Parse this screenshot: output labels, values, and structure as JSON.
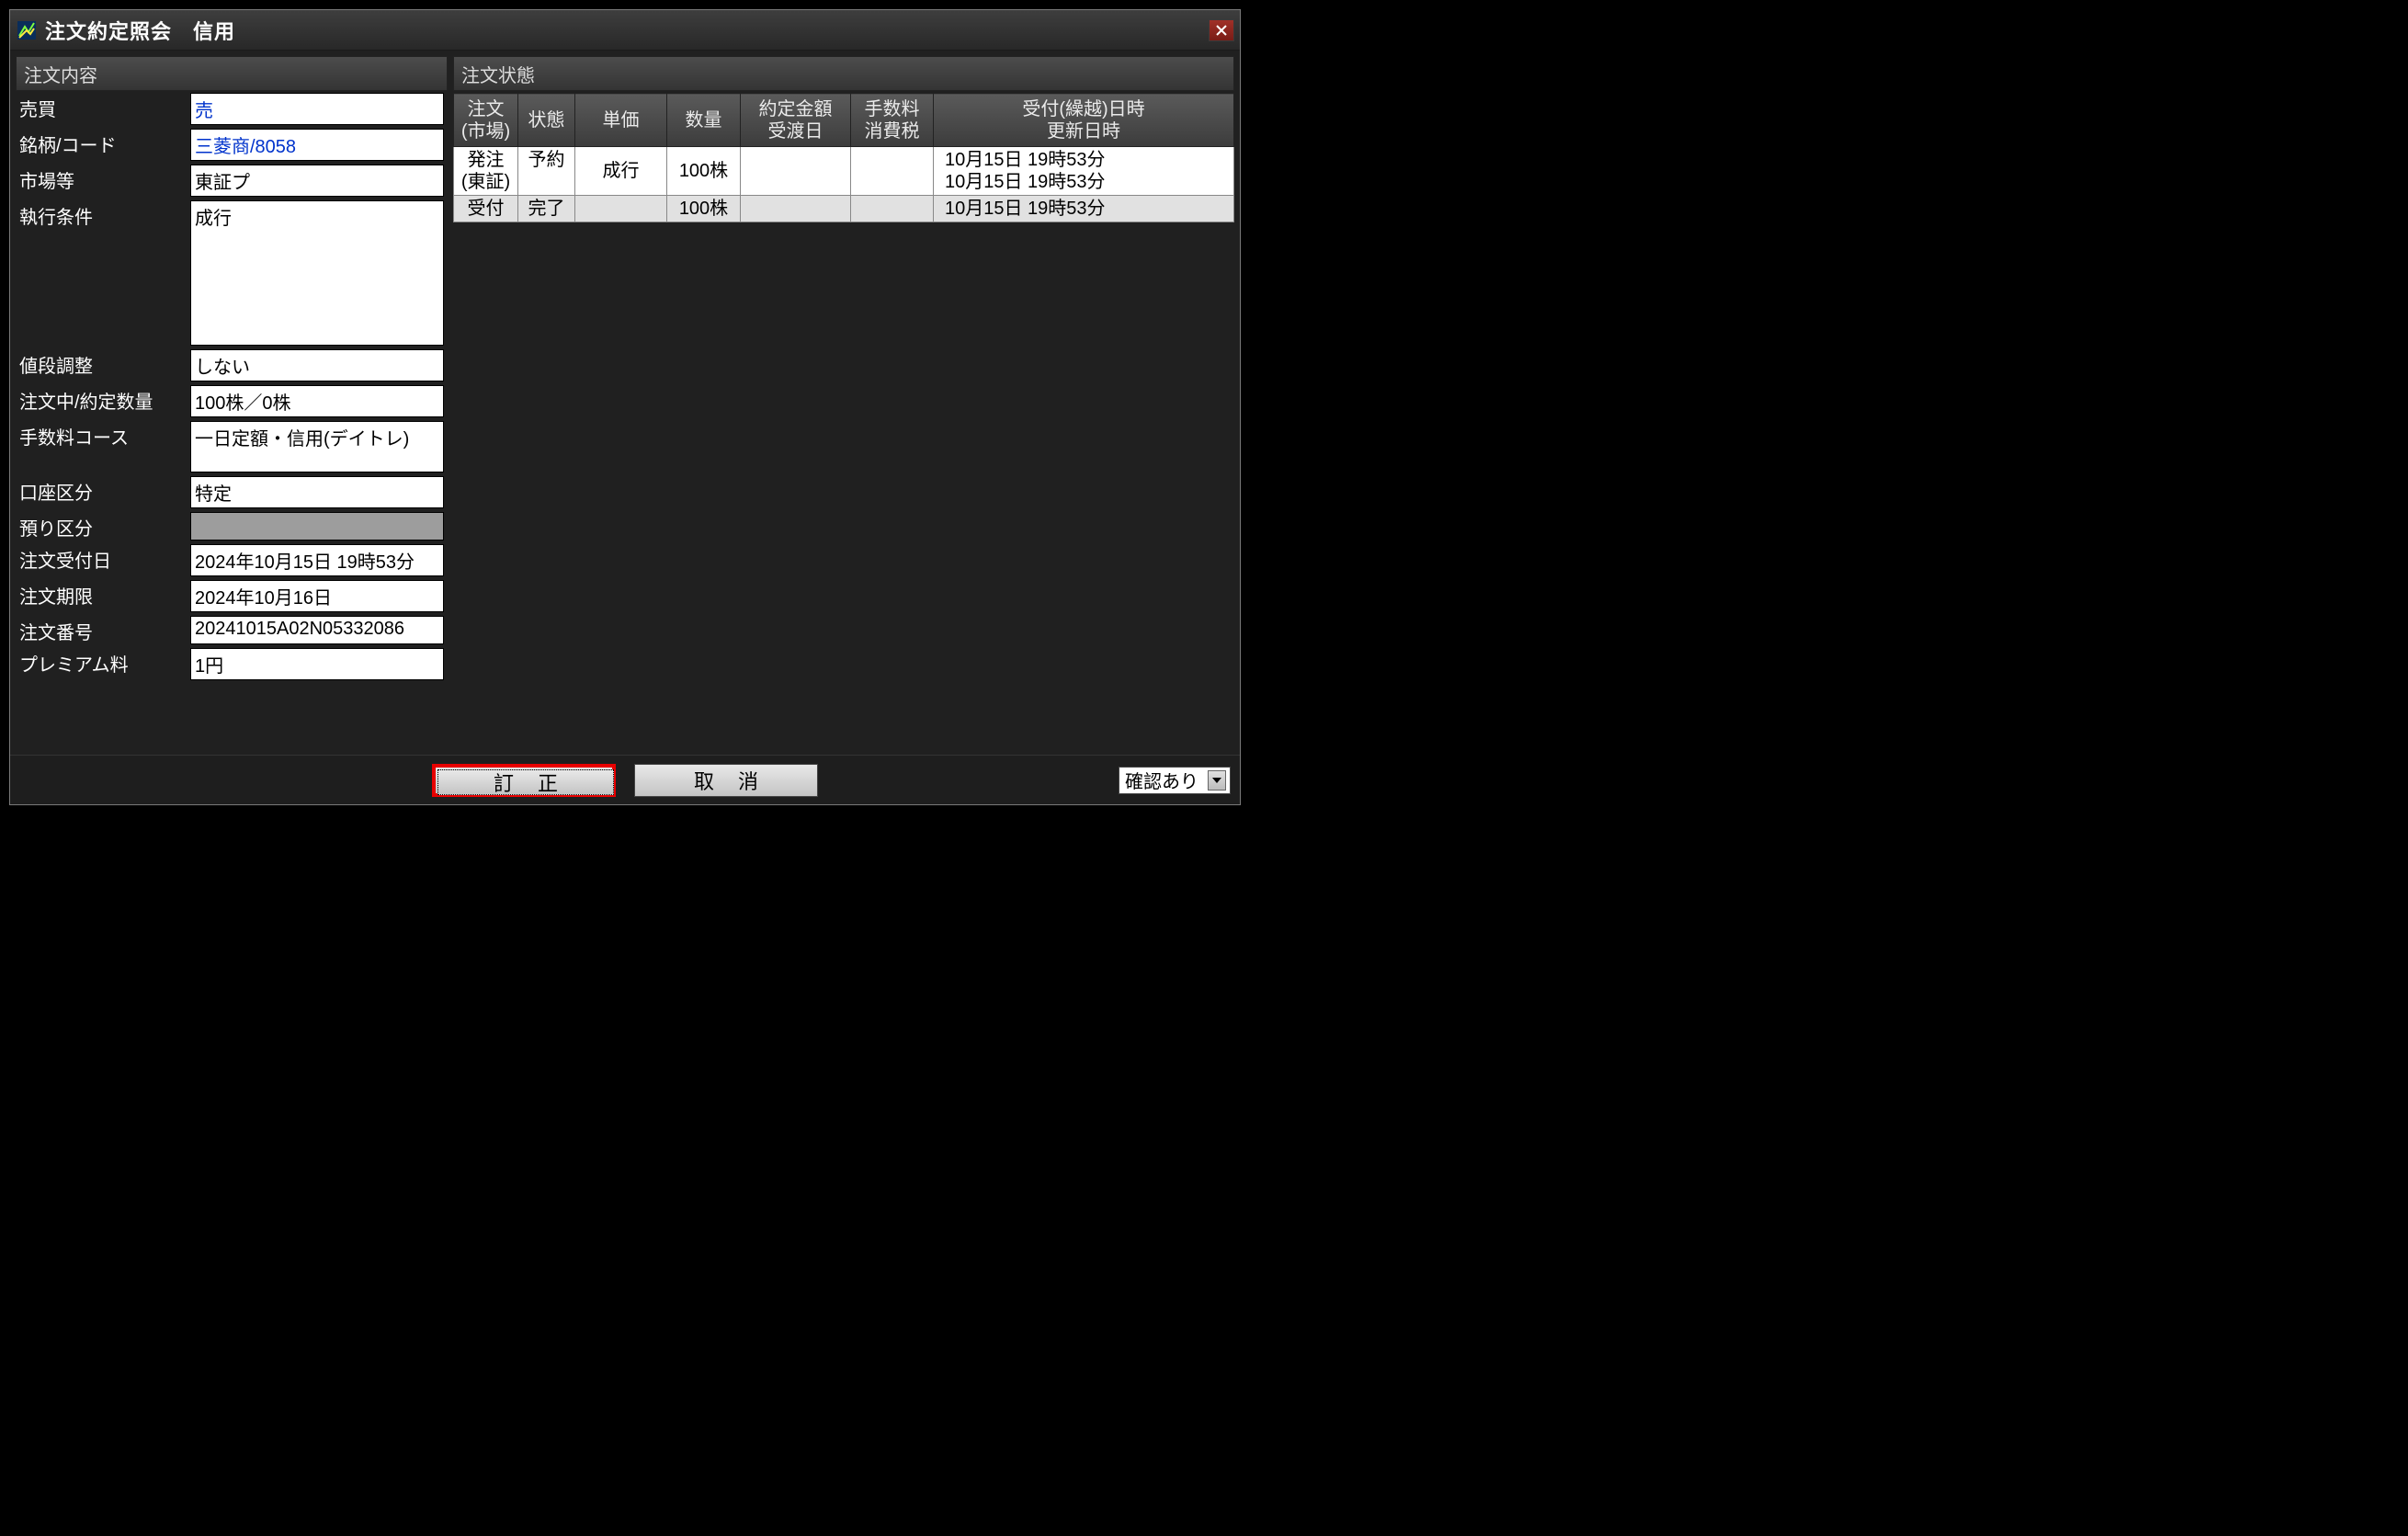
{
  "window": {
    "title": "注文約定照会　信用"
  },
  "left": {
    "header": "注文内容",
    "rows": {
      "buysell": {
        "label": "売買",
        "value": "売"
      },
      "stock": {
        "label": "銘柄/コード",
        "value": "三菱商/8058"
      },
      "market": {
        "label": "市場等",
        "value": "東証プ"
      },
      "exec": {
        "label": "執行条件",
        "value": "成行"
      },
      "priceadj": {
        "label": "値段調整",
        "value": "しない"
      },
      "qty": {
        "label": "注文中/約定数量",
        "value": "100株／0株"
      },
      "fee": {
        "label": "手数料コース",
        "value": "一日定額・信用(デイトレ)"
      },
      "account": {
        "label": "口座区分",
        "value": "特定"
      },
      "custody": {
        "label": "預り区分",
        "value": ""
      },
      "recvdate": {
        "label": "注文受付日",
        "value": "2024年10月15日 19時53分"
      },
      "expire": {
        "label": "注文期限",
        "value": "2024年10月16日"
      },
      "orderno": {
        "label": "注文番号",
        "value": "20241015A02N05332086"
      },
      "premium": {
        "label": "プレミアム料",
        "value": "1円"
      }
    }
  },
  "right": {
    "header": "注文状態",
    "columns": {
      "c0": "注文\n(市場)",
      "c1": "状態",
      "c2": "単価",
      "c3": "数量",
      "c4": "約定金額\n受渡日",
      "c5": "手数料\n消費税",
      "c6": "受付(繰越)日時\n更新日時"
    },
    "rows": [
      {
        "c0": "発注\n(東証)",
        "c1": "予約",
        "c2": "成行",
        "c3": "100株",
        "c4": "",
        "c5": "",
        "c6": "10月15日 19時53分\n10月15日 19時53分"
      },
      {
        "c0": "受付",
        "c1": "完了",
        "c2": "",
        "c3": "100株",
        "c4": "",
        "c5": "",
        "c6": "10月15日 19時53分"
      }
    ]
  },
  "footer": {
    "correct": "訂 正",
    "cancel": "取 消",
    "confirm": "確認あり"
  }
}
